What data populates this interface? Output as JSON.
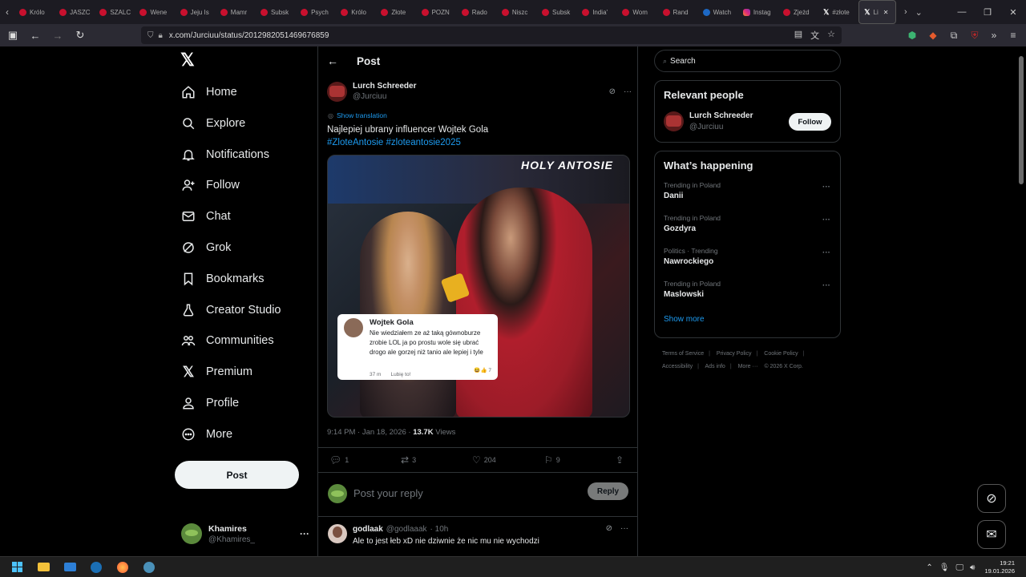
{
  "browser": {
    "tabs": [
      {
        "label": "Królo",
        "fav": "c"
      },
      {
        "label": "JASZC",
        "fav": "c"
      },
      {
        "label": "SZALC",
        "fav": "c"
      },
      {
        "label": "Wene",
        "fav": "c"
      },
      {
        "label": "Jeju Is",
        "fav": "c"
      },
      {
        "label": "Mamr",
        "fav": "c"
      },
      {
        "label": "Subsk",
        "fav": "c"
      },
      {
        "label": "Psych",
        "fav": "c"
      },
      {
        "label": "Królo",
        "fav": "c"
      },
      {
        "label": "Złote",
        "fav": "c"
      },
      {
        "label": "POZN",
        "fav": "c"
      },
      {
        "label": "Rado",
        "fav": "c"
      },
      {
        "label": "Niszc",
        "fav": "c"
      },
      {
        "label": "Subsk",
        "fav": "c"
      },
      {
        "label": "India'",
        "fav": "c"
      },
      {
        "label": "Wom",
        "fav": "c"
      },
      {
        "label": "Rand",
        "fav": "c"
      },
      {
        "label": "Watch",
        "fav": "watch"
      },
      {
        "label": "Instag",
        "fav": "ig"
      },
      {
        "label": "Zjeżd",
        "fav": "c"
      },
      {
        "label": "#złote",
        "fav": "x"
      },
      {
        "label": "Li",
        "fav": "x",
        "active": true
      }
    ],
    "url": "x.com/Jurciuu/status/2012982051469676859"
  },
  "sidebar": {
    "nav": [
      {
        "label": "Home",
        "icon": "home-icon"
      },
      {
        "label": "Explore",
        "icon": "search-icon"
      },
      {
        "label": "Notifications",
        "icon": "bell-icon"
      },
      {
        "label": "Follow",
        "icon": "person-add-icon"
      },
      {
        "label": "Chat",
        "icon": "mail-icon"
      },
      {
        "label": "Grok",
        "icon": "grok-icon"
      },
      {
        "label": "Bookmarks",
        "icon": "bookmark-icon"
      },
      {
        "label": "Creator Studio",
        "icon": "flask-icon"
      },
      {
        "label": "Communities",
        "icon": "communities-icon"
      },
      {
        "label": "Premium",
        "icon": "x-icon"
      },
      {
        "label": "Profile",
        "icon": "profile-icon"
      },
      {
        "label": "More",
        "icon": "more-circle-icon"
      }
    ],
    "post_label": "Post",
    "account": {
      "name": "Khamires",
      "handle": "@Khamires_"
    }
  },
  "main": {
    "header_title": "Post",
    "author": {
      "name": "Lurch Schreeder",
      "handle": "@Jurciuu"
    },
    "show_translation": "Show translation",
    "text": "Najlepiej ubrany influencer Wojtek Gola",
    "hashtags": "#ZloteAntosie #zloteantosie2025",
    "media": {
      "banner_text": "HOLY  ANTOSIE",
      "comment_name": "Wojtek Gola",
      "comment_text": "Nie wiedziałem ze aż taką gównoburze zrobie LOL ja po prostu wole się ubrać drogo ale gorzej niż tanio ale lepiej i tyle",
      "comment_time": "37 m",
      "comment_like": "Lubię to!",
      "comment_reactions": "7"
    },
    "timestamp": "9:14 PM · Jan 18, 2026 · ",
    "views_count": "13.7K",
    "views_label": " Views",
    "actions": {
      "replies": "1",
      "reposts": "3",
      "likes": "204",
      "bookmarks": "9"
    },
    "reply_placeholder": "Post your reply",
    "reply_button": "Reply",
    "reply": {
      "name": "godlaak",
      "handle": "@godlaaak",
      "time": "· 10h",
      "text": "Ale to jest łeb xD nie dziwnie że nic mu nie wychodzi"
    }
  },
  "right": {
    "search_placeholder": "Search",
    "relevant_title": "Relevant people",
    "person": {
      "name": "Lurch Schreeder",
      "handle": "@Jurciuu",
      "follow": "Follow"
    },
    "happening_title": "What’s happening",
    "trends": [
      {
        "context": "Trending in Poland",
        "name": "Danii"
      },
      {
        "context": "Trending in Poland",
        "name": "Gozdyra"
      },
      {
        "context": "Politics · Trending",
        "name": "Nawrockiego"
      },
      {
        "context": "Trending in Poland",
        "name": "Maslowski"
      }
    ],
    "show_more": "Show more",
    "footer": [
      "Terms of Service",
      "Privacy Policy",
      "Cookie Policy",
      "Accessibility",
      "Ads info",
      "More ···",
      "© 2026 X Corp."
    ]
  },
  "taskbar": {
    "time": "19:21",
    "date": "19.01.2026"
  }
}
